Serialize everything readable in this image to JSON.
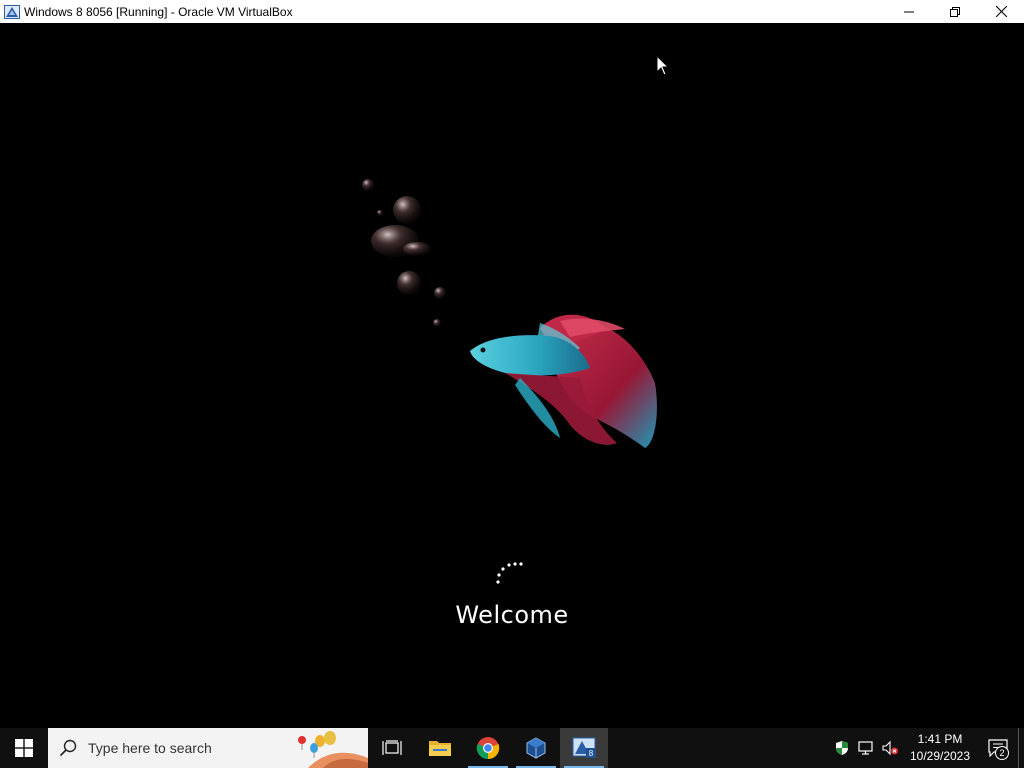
{
  "window": {
    "title": "Windows 8 8056 [Running] - Oracle VM VirtualBox",
    "app_icon": "virtualbox-icon",
    "controls": [
      "minimize-icon",
      "restore-icon",
      "close-icon"
    ]
  },
  "vm_screen": {
    "background_art": "betta-fish-with-bubbles",
    "status_text": "Welcome",
    "spinner": "loading-dots-icon"
  },
  "taskbar": {
    "start_icon": "windows-logo-icon",
    "search": {
      "placeholder": "Type here to search",
      "icon": "search-icon"
    },
    "apps": [
      {
        "name": "task-view",
        "icon": "task-view-icon",
        "running": false,
        "active": false
      },
      {
        "name": "file-explorer",
        "icon": "folder-icon",
        "running": false,
        "active": false
      },
      {
        "name": "chrome",
        "icon": "chrome-icon",
        "running": true,
        "active": false
      },
      {
        "name": "virtualbox-manager",
        "icon": "virtualbox-icon",
        "running": true,
        "active": false
      },
      {
        "name": "virtualbox-vm",
        "icon": "virtualbox-vm-icon",
        "running": true,
        "active": true
      }
    ],
    "tray": {
      "icons": [
        "defender-shield-icon",
        "network-icon",
        "volume-muted-icon"
      ],
      "time": "1:41 PM",
      "date": "10/29/2023",
      "notification_count": "2"
    }
  },
  "colors": {
    "titlebar_bg": "#ffffff",
    "screen_bg": "#000000",
    "taskbar_bg": "#101010",
    "accent": "#76b9ed"
  }
}
